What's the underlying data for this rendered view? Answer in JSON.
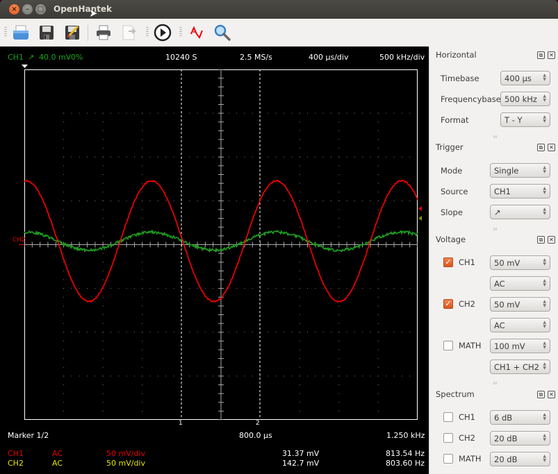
{
  "window": {
    "title": "OpenHantek"
  },
  "toolbar": {
    "icons": [
      "open-icon",
      "save-icon",
      "save-as-icon",
      "print-icon",
      "export-icon",
      "start-icon",
      "digital-phosphor-icon",
      "zoom-icon"
    ]
  },
  "scope": {
    "header": {
      "trigger_channel": "CH1",
      "trigger_slope": "↗",
      "trigger_level": "40.0 mV",
      "pretrigger": "0%",
      "record_length": "10240 S",
      "samplerate": "2.5 MS/s",
      "timebase": "400 µs/div",
      "freqbase": "500 kHz/div"
    },
    "ch2_marker_label": "CH2",
    "markers": {
      "m1_label": "1",
      "m2_label": "2"
    },
    "marker_info": {
      "label": "Marker 1/2",
      "time": "800.0 µs",
      "freq": "1.250 kHz"
    },
    "channels": [
      {
        "name": "CH1",
        "coupling": "AC",
        "gain": "50 mV/div",
        "amplitude": "31.37 mV",
        "frequency": "813.54 Hz",
        "color": "#e60000"
      },
      {
        "name": "CH2",
        "coupling": "AC",
        "gain": "50 mV/div",
        "amplitude": "142.7 mV",
        "frequency": "803.60 Hz",
        "color": "#e6e600"
      }
    ],
    "colors": {
      "ch1_trace": "#ff0000",
      "ch2_trace": "#1ea01e",
      "grid": "#808080"
    }
  },
  "panel": {
    "horizontal": {
      "title": "Horizontal",
      "timebase_label": "Timebase",
      "timebase_value": "400 µs",
      "freqbase_label": "Frequencybase",
      "freqbase_value": "500 kHz",
      "format_label": "Format",
      "format_value": "T - Y"
    },
    "trigger": {
      "title": "Trigger",
      "mode_label": "Mode",
      "mode_value": "Single",
      "source_label": "Source",
      "source_value": "CH1",
      "slope_label": "Slope",
      "slope_value": "↗"
    },
    "voltage": {
      "title": "Voltage",
      "ch1_label": "CH1",
      "ch1_checked": true,
      "ch1_gain": "50 mV",
      "ch1_coupling": "AC",
      "ch2_label": "CH2",
      "ch2_checked": true,
      "ch2_gain": "50 mV",
      "ch2_coupling": "AC",
      "math_label": "MATH",
      "math_checked": false,
      "math_gain": "100 mV",
      "math_mode": "CH1 + CH2"
    },
    "spectrum": {
      "title": "Spectrum",
      "ch1_label": "CH1",
      "ch1_checked": false,
      "ch1_mag": "6 dB",
      "ch2_label": "CH2",
      "ch2_checked": false,
      "ch2_mag": "20 dB",
      "math_label": "MATH",
      "math_checked": false,
      "math_mag": "20 dB"
    }
  }
}
